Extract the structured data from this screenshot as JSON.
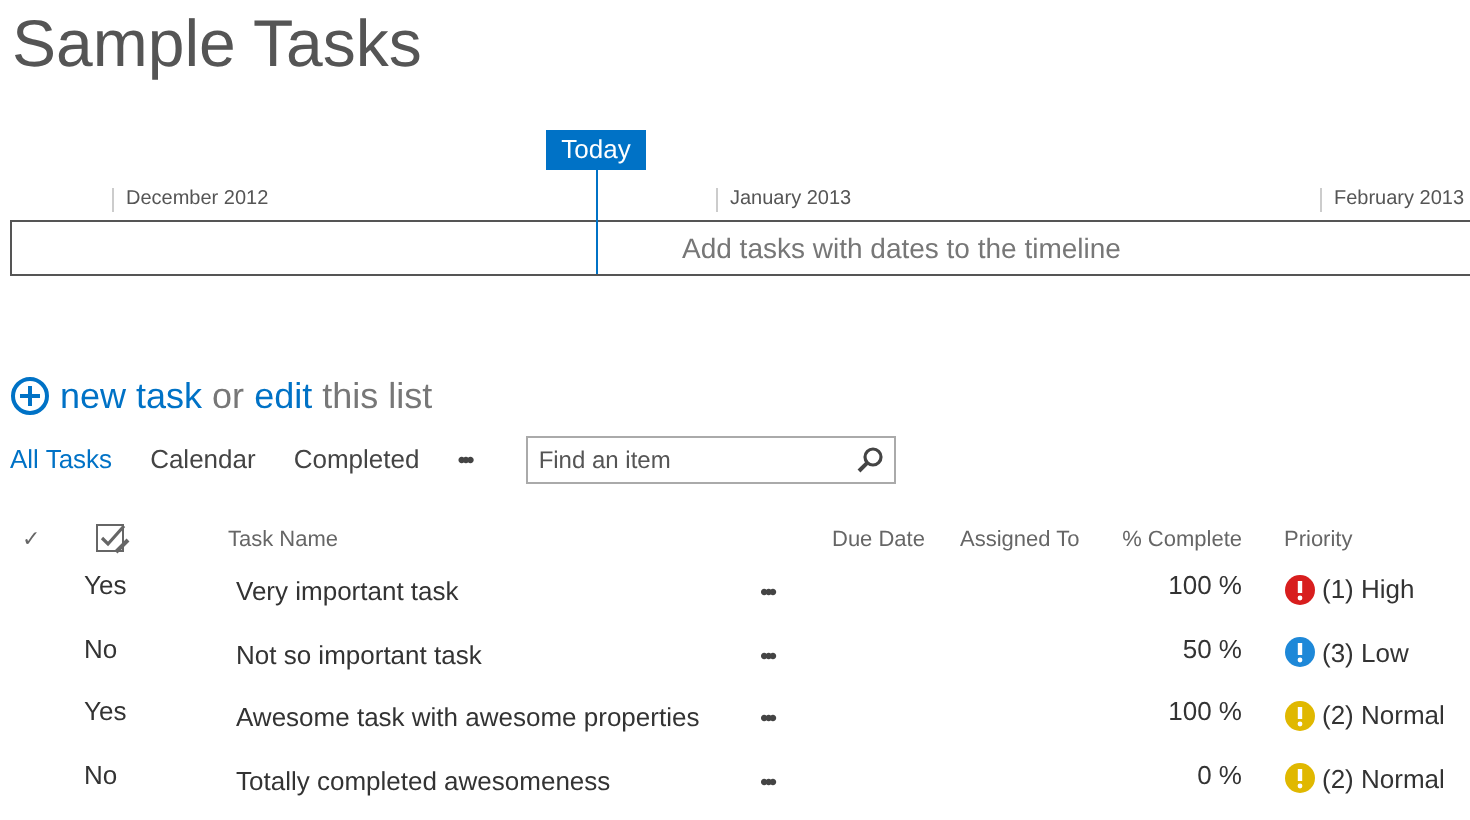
{
  "title": "Sample Tasks",
  "timeline": {
    "today_label": "Today",
    "months": [
      "December 2012",
      "January 2013",
      "February 2013"
    ],
    "placeholder": "Add tasks with dates to the timeline"
  },
  "actions": {
    "new_task": "new task",
    "or": "or",
    "edit": "edit",
    "rest": "this list"
  },
  "views": [
    {
      "label": "All Tasks",
      "selected": true
    },
    {
      "label": "Calendar",
      "selected": false
    },
    {
      "label": "Completed",
      "selected": false
    }
  ],
  "more_views": "•••",
  "search": {
    "placeholder": "Find an item"
  },
  "columns": {
    "check": "✓",
    "name": "Task Name",
    "due": "Due Date",
    "assigned": "Assigned To",
    "percent": "% Complete",
    "priority": "Priority"
  },
  "rows": [
    {
      "completed": "Yes",
      "name": "Very important task",
      "menu": "•••",
      "percent": "100 %",
      "priority": "(1) High",
      "color": "#d81e1e"
    },
    {
      "completed": "No",
      "name": "Not so important task",
      "menu": "•••",
      "percent": "50 %",
      "priority": "(3) Low",
      "color": "#1e88d8"
    },
    {
      "completed": "Yes",
      "name": "Awesome task with awesome properties",
      "menu": "•••",
      "percent": "100 %",
      "priority": "(2) Normal",
      "color": "#e0b800"
    },
    {
      "completed": "No",
      "name": "Totally completed awesomeness",
      "menu": "•••",
      "percent": "0 %",
      "priority": "(2) Normal",
      "color": "#e0b800"
    }
  ]
}
